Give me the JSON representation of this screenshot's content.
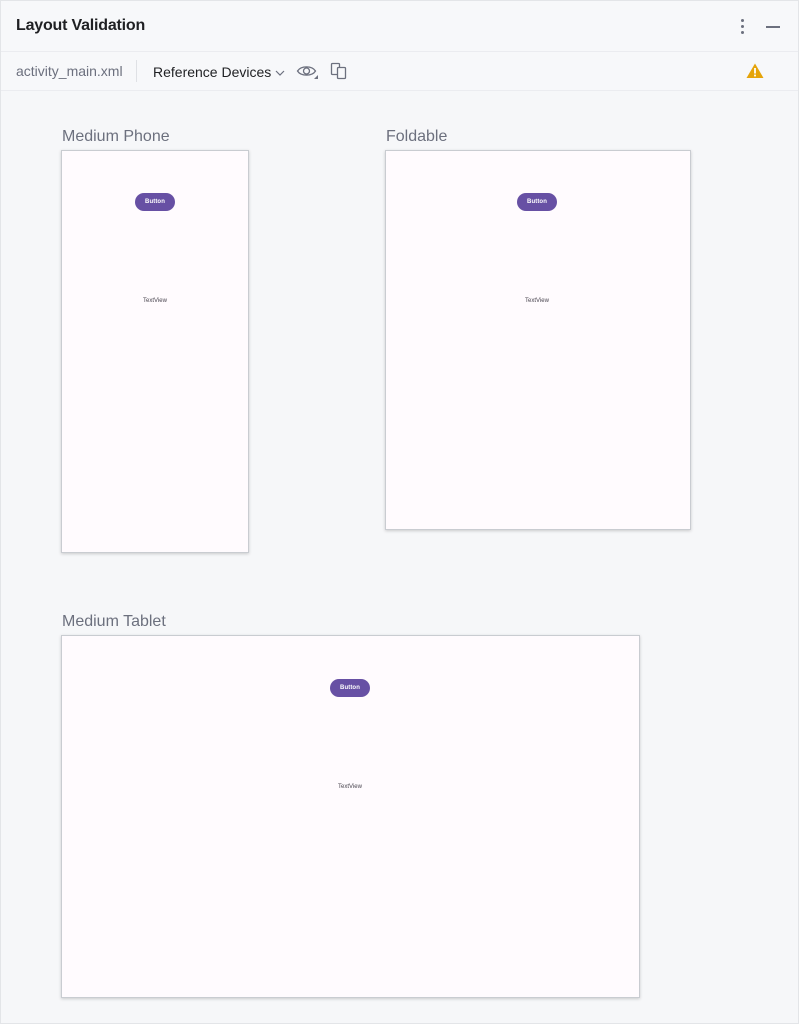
{
  "panel": {
    "title": "Layout Validation"
  },
  "toolbar": {
    "file_name": "activity_main.xml",
    "devices_label": "Reference Devices"
  },
  "icons": {
    "more": "more-vertical-icon",
    "minimize": "minimize-icon",
    "dropdown": "chevron-down-icon",
    "visibility": "eye-icon",
    "copy": "copy-icon",
    "warning": "warning-icon"
  },
  "colors": {
    "button_fill": "#6750a4",
    "warning": "#e5a40a",
    "device_background": "#fffbfe"
  },
  "devices": [
    {
      "label": "Medium Phone",
      "button_label": "Button",
      "text_view_label": "TextView"
    },
    {
      "label": "Foldable",
      "button_label": "Button",
      "text_view_label": "TextView"
    },
    {
      "label": "Medium Tablet",
      "button_label": "Button",
      "text_view_label": "TextView"
    }
  ]
}
